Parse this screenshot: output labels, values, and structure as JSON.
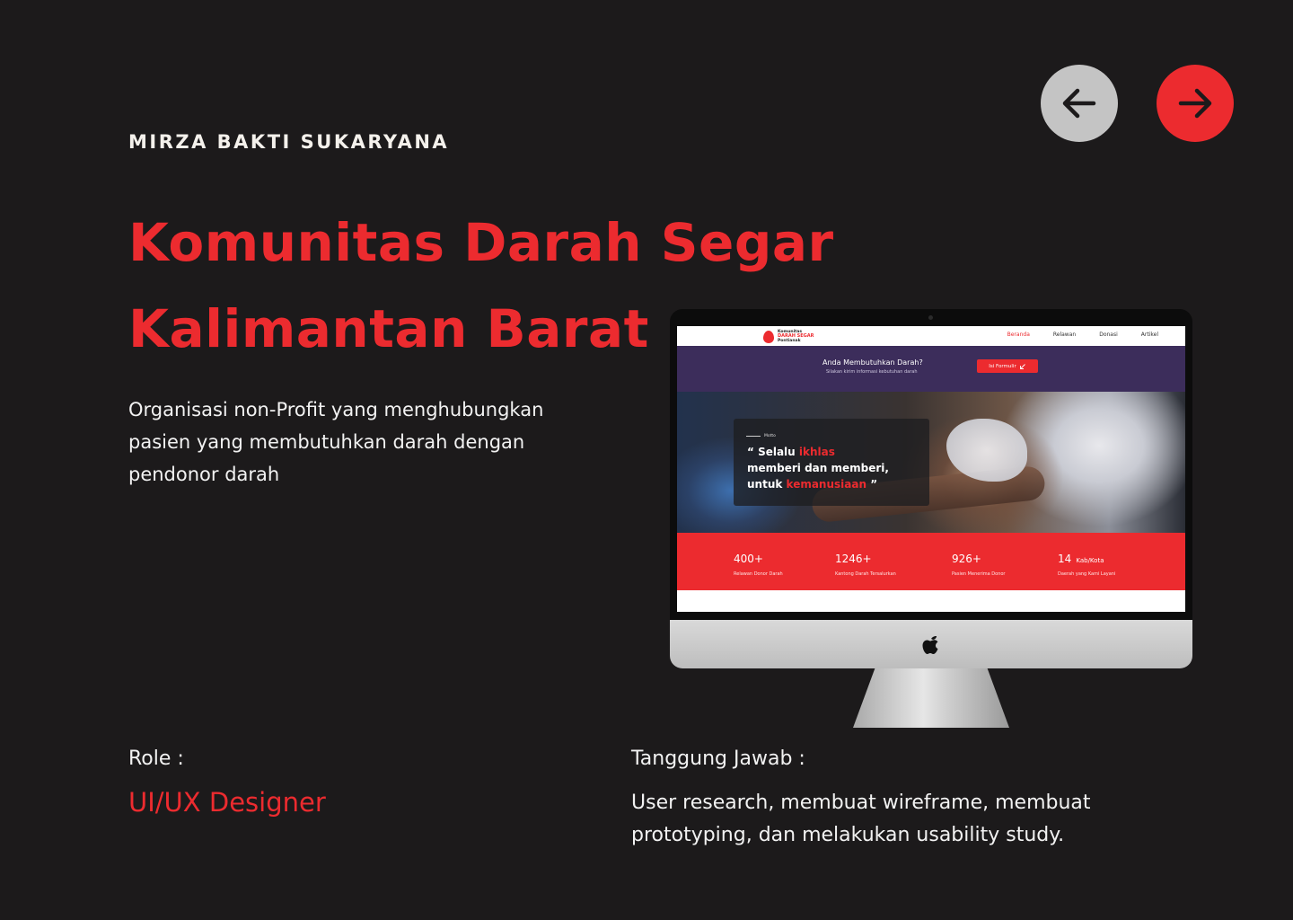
{
  "author": "MIRZA BAKTI SUKARYANA",
  "title_line1": "Komunitas Darah Segar",
  "title_line2": "Kalimantan Barat",
  "description": "Organisasi non-Profit yang menghubungkan pasien yang membutuhkan darah dengan pendonor darah",
  "nav": {
    "prev_icon": "arrow-left-icon",
    "next_icon": "arrow-right-icon"
  },
  "role": {
    "label": "Role :",
    "value": "UI/UX Designer"
  },
  "responsibility": {
    "label": "Tanggung Jawab :",
    "value": "User research, membuat wireframe, membuat prototyping, dan melakukan usability study."
  },
  "mockup": {
    "logo": {
      "line1": "Komunitas",
      "line2": "DARAH SEGAR",
      "line3": "Pontianak"
    },
    "menu": [
      "Beranda",
      "Relawan",
      "Donasi",
      "Artikel"
    ],
    "banner": {
      "title": "Anda Membutuhkan Darah?",
      "subtitle": "Silakan kirim informasi kebutuhan darah",
      "button": "Isi Formulir"
    },
    "hero": {
      "label": "Motto",
      "quote_open": "“ Selalu ",
      "quote_red1": "ikhlas",
      "quote_mid": "memberi dan memberi,",
      "quote_untuk": "untuk ",
      "quote_red2": "kemanusiaan",
      "quote_close": " ”"
    },
    "stats": [
      {
        "num": "400+",
        "unit": "",
        "label": "Relawan Donor Darah"
      },
      {
        "num": "1246+",
        "unit": "",
        "label": "Kantong Darah Tersalurkan"
      },
      {
        "num": "926+",
        "unit": "",
        "label": "Pasien Menerima Donor"
      },
      {
        "num": "14",
        "unit": "Kab/Kota",
        "label": "Daerah yang Kami Layani"
      }
    ]
  },
  "colors": {
    "background": "#1c1a1b",
    "accent": "#ec2b2f",
    "banner": "#3c2d5b",
    "prev_button": "#c4c4c4"
  }
}
